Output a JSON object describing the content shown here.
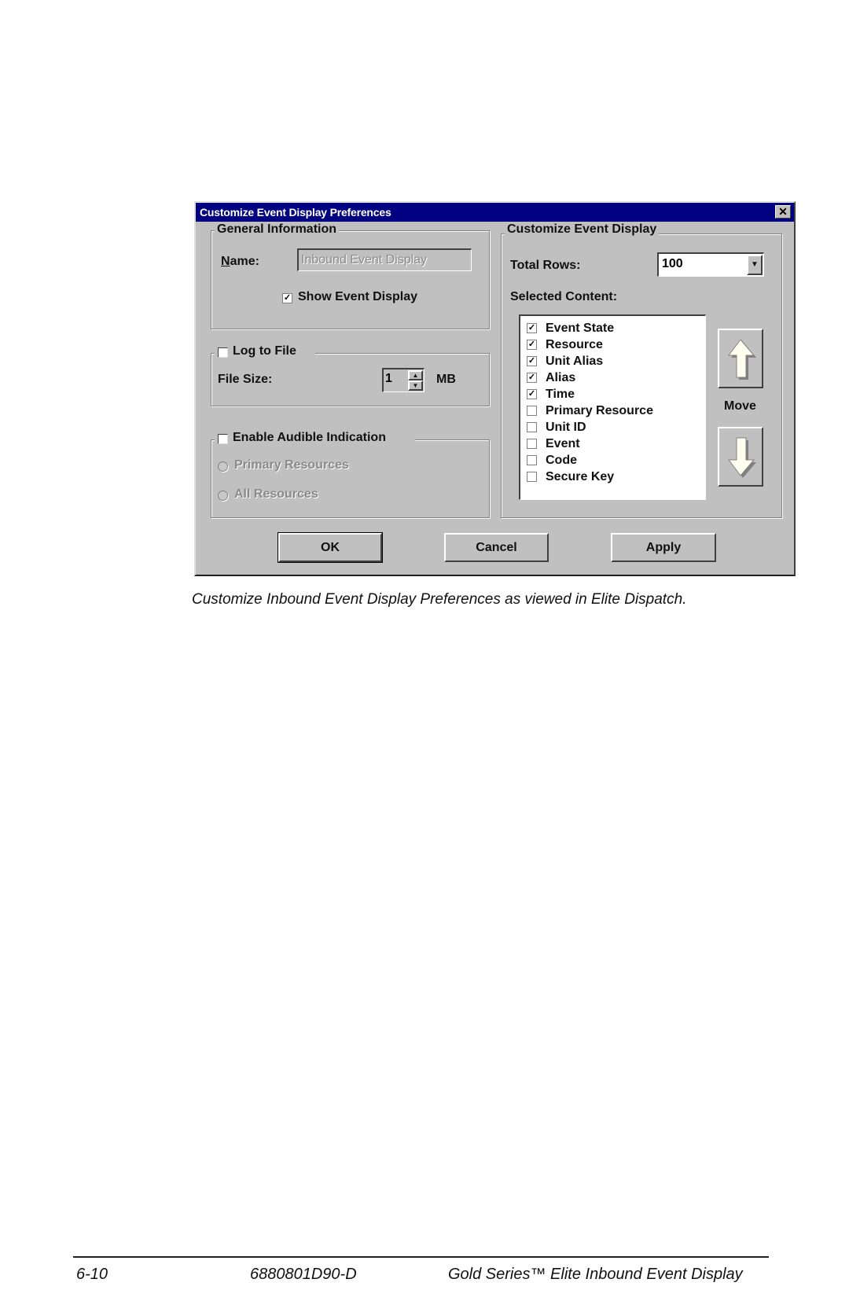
{
  "dialog": {
    "title": "Customize Event Display Preferences",
    "close_icon": "close-icon",
    "general": {
      "legend": "General Information",
      "name_label": "Name:",
      "name_value": "Inbound Event Display",
      "show_event_display": {
        "label": "Show Event Display",
        "checked": true
      }
    },
    "log_to_file": {
      "label": "Log to File",
      "checked": false,
      "file_size_label": "File Size:",
      "file_size_value": "1",
      "unit": "MB"
    },
    "audible": {
      "label": "Enable Audible Indication",
      "checked": false,
      "options": [
        {
          "label": "Primary Resources",
          "selected": false,
          "enabled": false
        },
        {
          "label": "All Resources",
          "selected": false,
          "enabled": false
        }
      ]
    },
    "customize": {
      "legend": "Customize Event Display",
      "total_rows_label": "Total Rows:",
      "total_rows_value": "100",
      "selected_content_label": "Selected Content:",
      "items": [
        {
          "label": "Event State",
          "checked": true
        },
        {
          "label": "Resource",
          "checked": true
        },
        {
          "label": "Unit Alias",
          "checked": true
        },
        {
          "label": "Alias",
          "checked": true
        },
        {
          "label": "Time",
          "checked": true
        },
        {
          "label": "Primary Resource",
          "checked": false
        },
        {
          "label": "Unit ID",
          "checked": false
        },
        {
          "label": "Event",
          "checked": false
        },
        {
          "label": "Code",
          "checked": false
        },
        {
          "label": "Secure Key",
          "checked": false
        }
      ],
      "move_label": "Move",
      "move_up_icon": "arrow-up-icon",
      "move_down_icon": "arrow-down-icon"
    },
    "buttons": {
      "ok": "OK",
      "cancel": "Cancel",
      "apply": "Apply"
    }
  },
  "caption": "Customize Inbound Event Display Preferences as viewed in Elite Dispatch.",
  "footer": {
    "page_number": "6-10",
    "doc_number": "6880801D90-D",
    "doc_title": "Gold Series™ Elite Inbound Event Display"
  }
}
